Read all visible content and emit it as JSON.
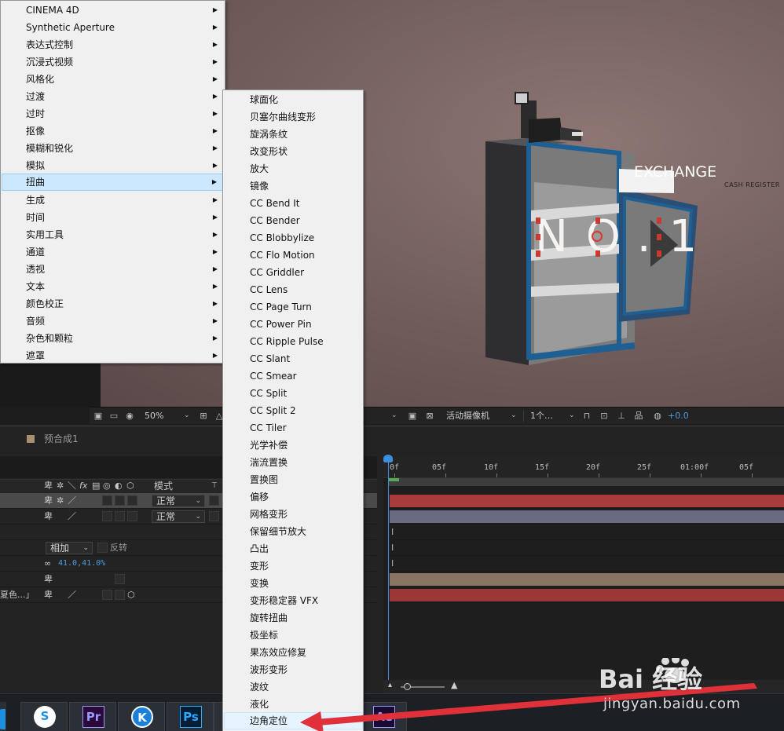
{
  "viewer": {
    "text_layer": "NO.1",
    "sign_exchange": "EXCHANGE",
    "sign_register": "CASH REGISTER",
    "toolbar": {
      "zoom": "50%",
      "camera": "活动摄像机",
      "views": "1个…",
      "exposure": "+0.0"
    }
  },
  "effect_menu": {
    "items": [
      {
        "label": "CINEMA 4D",
        "submenu": true
      },
      {
        "label": "Synthetic Aperture",
        "submenu": true
      },
      {
        "label": "表达式控制",
        "submenu": true
      },
      {
        "label": "沉浸式视频",
        "submenu": true
      },
      {
        "label": "风格化",
        "submenu": true
      },
      {
        "label": "过渡",
        "submenu": true
      },
      {
        "label": "过时",
        "submenu": true
      },
      {
        "label": "抠像",
        "submenu": true
      },
      {
        "label": "模糊和锐化",
        "submenu": true
      },
      {
        "label": "模拟",
        "submenu": true
      },
      {
        "label": "扭曲",
        "submenu": true,
        "highlighted": true
      },
      {
        "label": "生成",
        "submenu": true
      },
      {
        "label": "时间",
        "submenu": true
      },
      {
        "label": "实用工具",
        "submenu": true
      },
      {
        "label": "通道",
        "submenu": true
      },
      {
        "label": "透视",
        "submenu": true
      },
      {
        "label": "文本",
        "submenu": true
      },
      {
        "label": "颜色校正",
        "submenu": true
      },
      {
        "label": "音频",
        "submenu": true
      },
      {
        "label": "杂色和颗粒",
        "submenu": true
      },
      {
        "label": "遮罩",
        "submenu": true
      }
    ]
  },
  "distort_menu": {
    "items": [
      {
        "label": "球面化"
      },
      {
        "label": "贝塞尔曲线变形"
      },
      {
        "label": "旋涡条纹"
      },
      {
        "label": "改变形状"
      },
      {
        "label": "放大"
      },
      {
        "label": "镜像"
      },
      {
        "label": "CC Bend It"
      },
      {
        "label": "CC Bender"
      },
      {
        "label": "CC Blobbylize"
      },
      {
        "label": "CC Flo Motion"
      },
      {
        "label": "CC Griddler"
      },
      {
        "label": "CC Lens"
      },
      {
        "label": "CC Page Turn"
      },
      {
        "label": "CC Power Pin"
      },
      {
        "label": "CC Ripple Pulse"
      },
      {
        "label": "CC Slant"
      },
      {
        "label": "CC Smear"
      },
      {
        "label": "CC Split"
      },
      {
        "label": "CC Split 2"
      },
      {
        "label": "CC Tiler"
      },
      {
        "label": "光学补偿"
      },
      {
        "label": "湍流置换"
      },
      {
        "label": "置换图"
      },
      {
        "label": "偏移"
      },
      {
        "label": "网格变形"
      },
      {
        "label": "保留细节放大"
      },
      {
        "label": "凸出"
      },
      {
        "label": "变形"
      },
      {
        "label": "变换"
      },
      {
        "label": "变形稳定器 VFX"
      },
      {
        "label": "旋转扭曲"
      },
      {
        "label": "极坐标"
      },
      {
        "label": "果冻效应修复"
      },
      {
        "label": "波形变形"
      },
      {
        "label": "波纹"
      },
      {
        "label": "液化"
      },
      {
        "label": "边角定位",
        "highlighted": true
      }
    ]
  },
  "timeline": {
    "comp_tab": "预合成1",
    "header": {
      "mode": "模式",
      "t": "T"
    },
    "rows": [
      {
        "mode": "正常"
      },
      {
        "mode": "正常"
      },
      {
        "blend": "相加",
        "invert": "反转"
      },
      {
        "scale": "41.0,41.0%"
      },
      {},
      {
        "name": "夏色...」"
      }
    ],
    "ruler": [
      "0f",
      "05f",
      "10f",
      "15f",
      "20f",
      "25f",
      "01:00f",
      "05f"
    ],
    "track_colors": [
      "#a83c3c",
      "#6a6a82",
      "#2a2a2a",
      "#2a2a2a",
      "#2a2a2a",
      "#8a7565",
      "#9a3838"
    ]
  },
  "taskbar": {
    "apps": [
      {
        "name": "sogou",
        "label": "S",
        "color": "#1d8fe0"
      },
      {
        "name": "premiere",
        "label": "Pr",
        "color": "#9999ff",
        "bg": "#2a0a3a"
      },
      {
        "name": "kuwo",
        "label": "K",
        "color": "#ffffff",
        "bg": "#1a7fd8"
      },
      {
        "name": "photoshop",
        "label": "Ps",
        "color": "#31a8ff",
        "bg": "#001e36"
      },
      {
        "name": "after-effects",
        "label": "Ae",
        "color": "#9999ff",
        "bg": "#1a0b33"
      }
    ]
  },
  "watermark": {
    "brand": "Bai 经验",
    "url": "jingyan.baidu.com"
  },
  "colors": {
    "menu_bg": "#f0f0f0",
    "menu_highlight": "#cce8ff",
    "accent_blue": "#3b8de0",
    "annotation_red": "#e0303a"
  }
}
